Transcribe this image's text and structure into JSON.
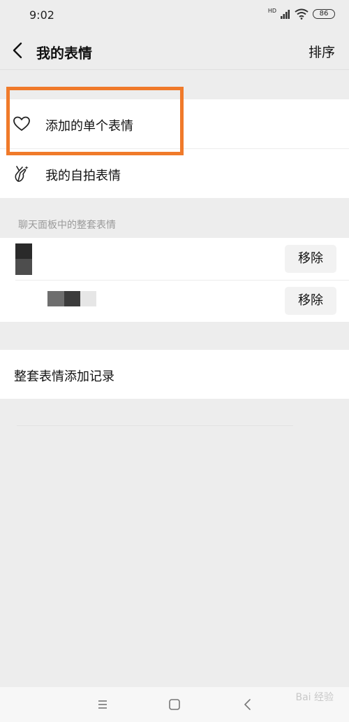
{
  "status_bar": {
    "time": "9:02",
    "network_label": "HD",
    "battery": "86"
  },
  "header": {
    "title": "我的表情",
    "sort_label": "排序"
  },
  "menu": {
    "items": [
      {
        "label": "添加的单个表情",
        "icon": "heart-icon"
      },
      {
        "label": "我的自拍表情",
        "icon": "hand-gesture-icon"
      }
    ]
  },
  "sticker_packs": {
    "section_title": "聊天面板中的整套表情",
    "packs": [
      {
        "remove_label": "移除"
      },
      {
        "remove_label": "移除"
      }
    ]
  },
  "records": {
    "label": "整套表情添加记录"
  },
  "watermark": "Bai 经验",
  "colors": {
    "highlight": "#f07a2a",
    "background": "#ededed"
  }
}
